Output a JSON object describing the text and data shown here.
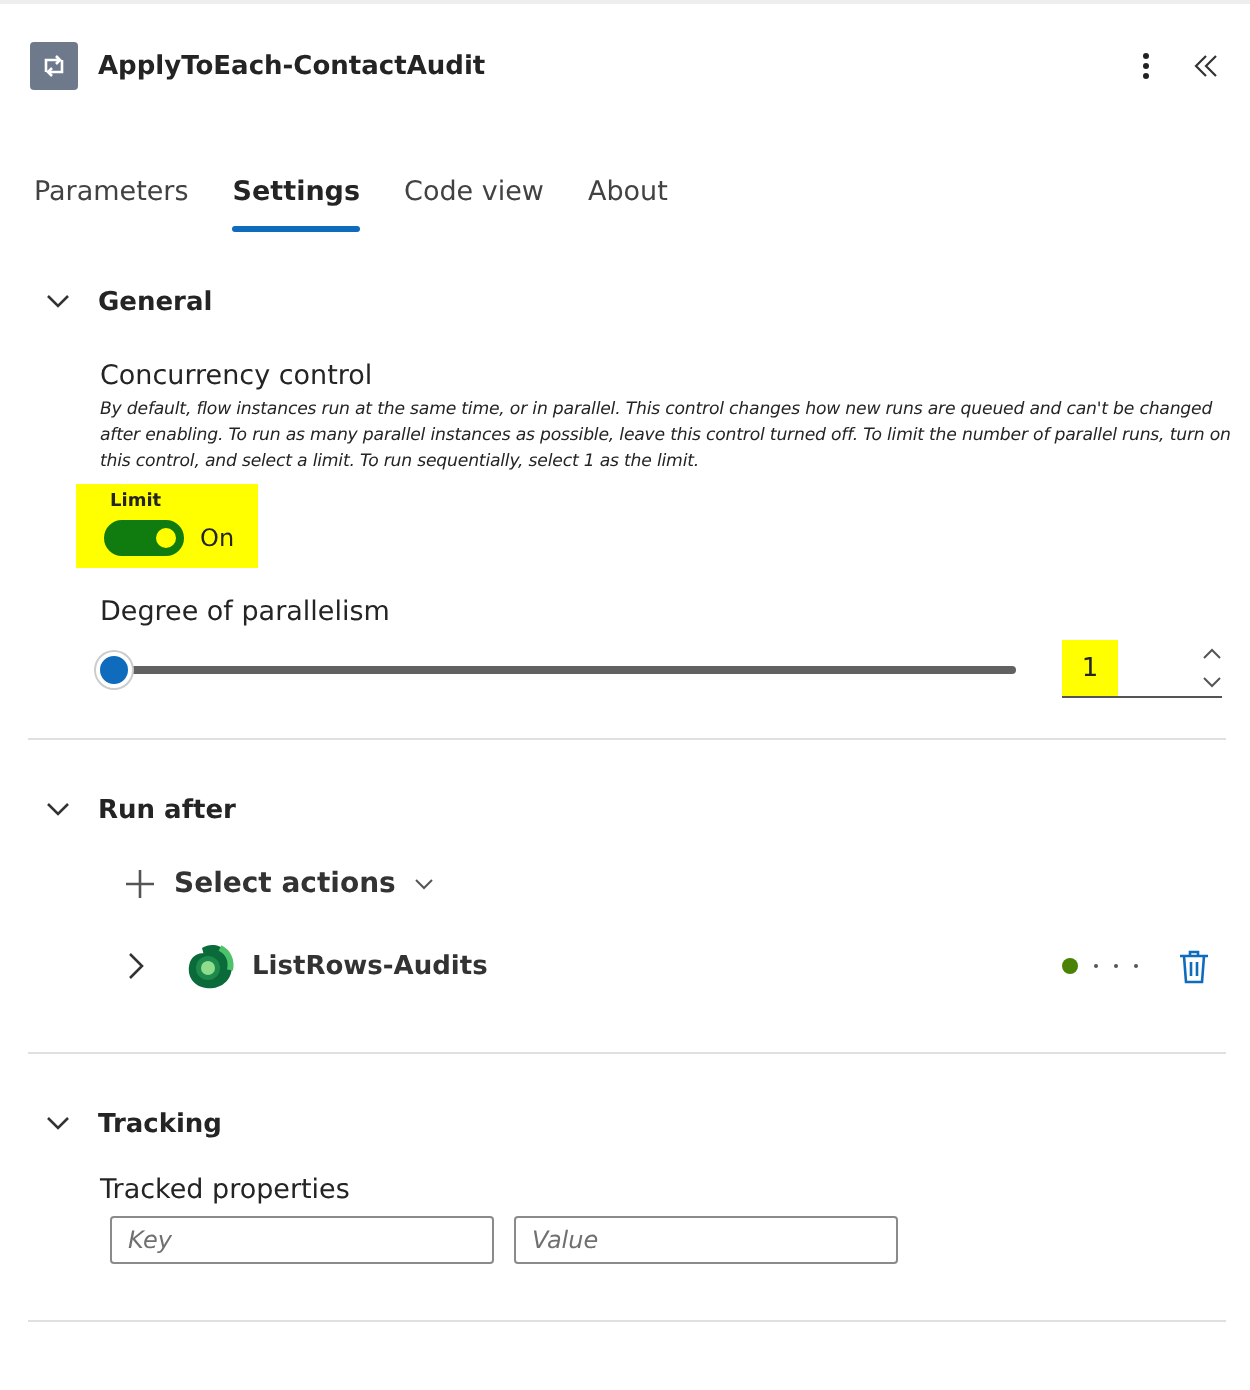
{
  "header": {
    "title": "ApplyToEach-ContactAudit"
  },
  "tabs": [
    {
      "label": "Parameters",
      "selected": false
    },
    {
      "label": "Settings",
      "selected": true
    },
    {
      "label": "Code view",
      "selected": false
    },
    {
      "label": "About",
      "selected": false
    }
  ],
  "general": {
    "title": "General",
    "expanded": true,
    "concurrency": {
      "title": "Concurrency control",
      "description": "By default, flow instances run at the same time, or in parallel. This control changes how new runs are queued and can't be changed after enabling. To run as many parallel instances as possible, leave this control turned off. To limit the number of parallel runs, turn on this control, and select a limit. To run sequentially, select 1 as the limit.",
      "toggle_label": "Limit",
      "on": true,
      "state_text": "On"
    },
    "parallelism": {
      "label": "Degree of parallelism",
      "level": 0,
      "value": "1"
    }
  },
  "run_after": {
    "title": "Run after",
    "expanded": true,
    "select_label": "Select actions",
    "actions": [
      {
        "name": "ListRows-Audits",
        "expanded": false,
        "color": "#498205"
      }
    ]
  },
  "tracking": {
    "title": "Tracking",
    "expanded": true,
    "label": "Tracked properties",
    "key_placeholder": "Key",
    "value_placeholder": "Value"
  }
}
